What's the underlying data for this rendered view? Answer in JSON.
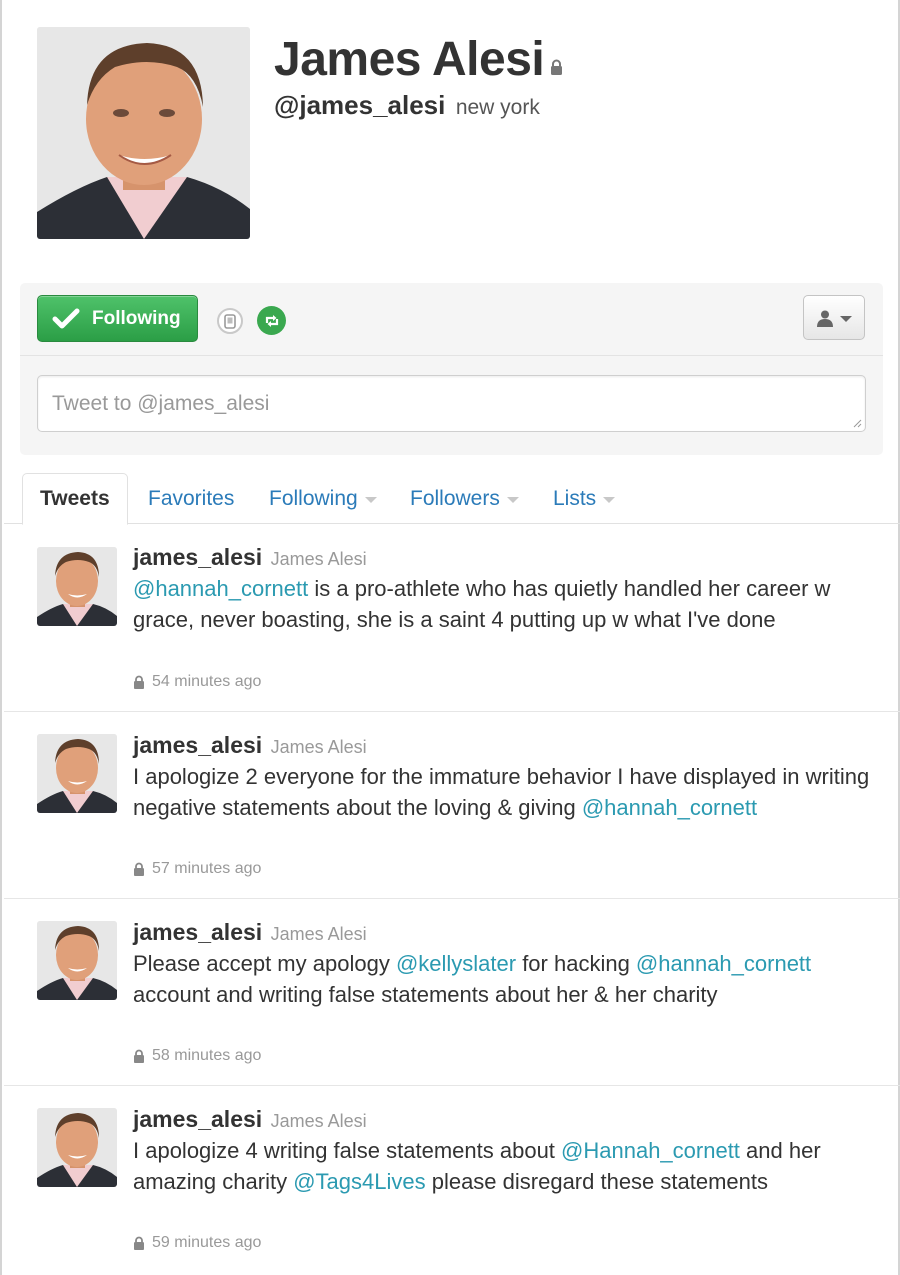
{
  "profile": {
    "full_name": "James Alesi",
    "screen_name": "@james_alesi",
    "location": "new york"
  },
  "actions": {
    "follow_label": "Following",
    "tweet_placeholder": "Tweet to @james_alesi"
  },
  "tabs": [
    {
      "label": "Tweets",
      "active": true
    },
    {
      "label": "Favorites"
    },
    {
      "label": "Following",
      "dropdown": true
    },
    {
      "label": "Followers",
      "dropdown": true
    },
    {
      "label": "Lists",
      "dropdown": true
    }
  ],
  "colors": {
    "follow_green": "#36ad52",
    "link_blue": "#2b7bb9",
    "mention_teal": "#2b9ab1",
    "muted_gray": "#999999"
  },
  "tweets": [
    {
      "username": "james_alesi",
      "name": "James Alesi",
      "parts": [
        {
          "text": "@hannah_cornett",
          "mention": true
        },
        {
          "text": " is a pro-athlete who has quietly handled her career w grace, never boasting, she is a saint 4 putting up w what I've done"
        }
      ],
      "time": "54 minutes ago"
    },
    {
      "username": "james_alesi",
      "name": "James Alesi",
      "parts": [
        {
          "text": "I apologize 2 everyone for the immature behavior I have displayed in writing negative statements about the loving & giving "
        },
        {
          "text": "@hannah_cornett",
          "mention": true
        }
      ],
      "time": "57 minutes ago"
    },
    {
      "username": "james_alesi",
      "name": "James Alesi",
      "parts": [
        {
          "text": "Please accept my apology "
        },
        {
          "text": "@kellyslater",
          "mention": true
        },
        {
          "text": " for hacking "
        },
        {
          "text": "@hannah_cornett",
          "mention": true
        },
        {
          "text": " account and writing false statements about her & her charity"
        }
      ],
      "time": "58 minutes ago"
    },
    {
      "username": "james_alesi",
      "name": "James Alesi",
      "parts": [
        {
          "text": "I apologize 4 writing false statements about "
        },
        {
          "text": "@Hannah_cornett",
          "mention": true
        },
        {
          "text": " and her amazing charity "
        },
        {
          "text": "@Tags4Lives",
          "mention": true
        },
        {
          "text": " please disregard these statements"
        }
      ],
      "time": "59 minutes ago"
    }
  ]
}
